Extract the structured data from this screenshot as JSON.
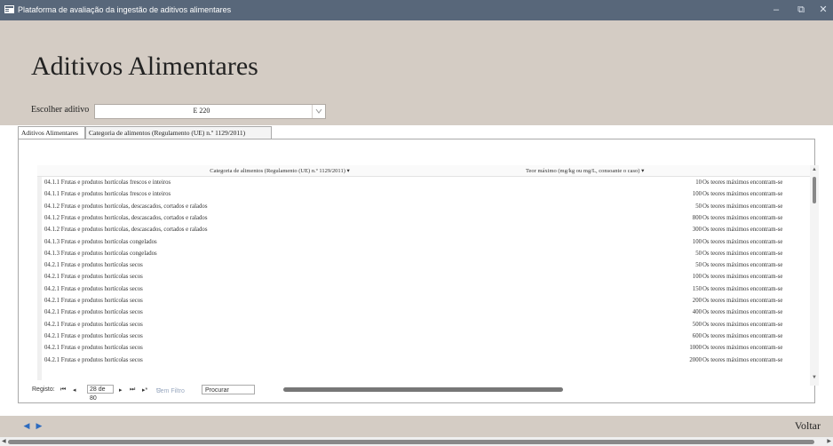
{
  "window": {
    "title": "Plataforma de avaliação da ingestão de aditivos alimentares",
    "minimize": "–",
    "restore": "⧉",
    "close": "✕"
  },
  "header": {
    "title": "Aditivos Alimentares",
    "choose_label": "Escolher aditivo",
    "additive_value": "E 220",
    "dropdown_icon": "chevron-down"
  },
  "tabs": [
    {
      "label": "Aditivos Alimentares"
    },
    {
      "label": "Categoria de alimentos (Regulamento (UE) n.º 1129/2011)"
    }
  ],
  "grid": {
    "columns": [
      "Categoria de alimentos (Regulamento (UE) n.º 1129/2011)",
      "Teor máximo (mg/kg ou mg/L, consoante o caso)",
      ""
    ],
    "rows": [
      {
        "cat": "04.1.1 Frutas e produtos hortícolas frescos e inteiros",
        "max": "10",
        "note": "Os teores máximos encontram-se"
      },
      {
        "cat": "04.1.1 Frutas e produtos hortícolas frescos e inteiros",
        "max": "100",
        "note": "Os teores máximos encontram-se"
      },
      {
        "cat": "04.1.2 Frutas e produtos hortícolas, descascados, cortados e ralados",
        "max": "50",
        "note": "Os teores máximos encontram-se"
      },
      {
        "cat": "04.1.2 Frutas e produtos hortícolas, descascados, cortados e ralados",
        "max": "800",
        "note": "Os teores máximos encontram-se"
      },
      {
        "cat": "04.1.2 Frutas e produtos hortícolas, descascados, cortados e ralados",
        "max": "300",
        "note": "Os teores máximos encontram-se"
      },
      {
        "cat": "04.1.3 Frutas e produtos hortícolas congelados",
        "max": "100",
        "note": "Os teores máximos encontram-se"
      },
      {
        "cat": "04.1.3 Frutas e produtos hortícolas congelados",
        "max": "50",
        "note": "Os teores máximos encontram-se"
      },
      {
        "cat": "04.2.1 Frutas e produtos hortícolas secos",
        "max": "50",
        "note": "Os teores máximos encontram-se"
      },
      {
        "cat": "04.2.1 Frutas e produtos hortícolas secos",
        "max": "100",
        "note": "Os teores máximos encontram-se"
      },
      {
        "cat": "04.2.1 Frutas e produtos hortícolas secos",
        "max": "150",
        "note": "Os teores máximos encontram-se"
      },
      {
        "cat": "04.2.1 Frutas e produtos hortícolas secos",
        "max": "200",
        "note": "Os teores máximos encontram-se"
      },
      {
        "cat": "04.2.1 Frutas e produtos hortícolas secos",
        "max": "400",
        "note": "Os teores máximos encontram-se"
      },
      {
        "cat": "04.2.1 Frutas e produtos hortícolas secos",
        "max": "500",
        "note": "Os teores máximos encontram-se"
      },
      {
        "cat": "04.2.1 Frutas e produtos hortícolas secos",
        "max": "600",
        "note": "Os teores máximos encontram-se"
      },
      {
        "cat": "04.2.1 Frutas e produtos hortícolas secos",
        "max": "1000",
        "note": "Os teores máximos encontram-se"
      },
      {
        "cat": "04.2.1 Frutas e produtos hortícolas secos",
        "max": "2000",
        "note": "Os teores máximos encontram-se"
      }
    ]
  },
  "record_nav": {
    "label": "Registo:",
    "first": "⏮",
    "prev": "◂",
    "position": "28 de 80",
    "next": "▸",
    "last": "⏭",
    "new": "▸*",
    "filter": "Sem Filtro",
    "search": "Procurar"
  },
  "footer": {
    "prev": "◀",
    "next": "▶",
    "back": "Voltar"
  }
}
